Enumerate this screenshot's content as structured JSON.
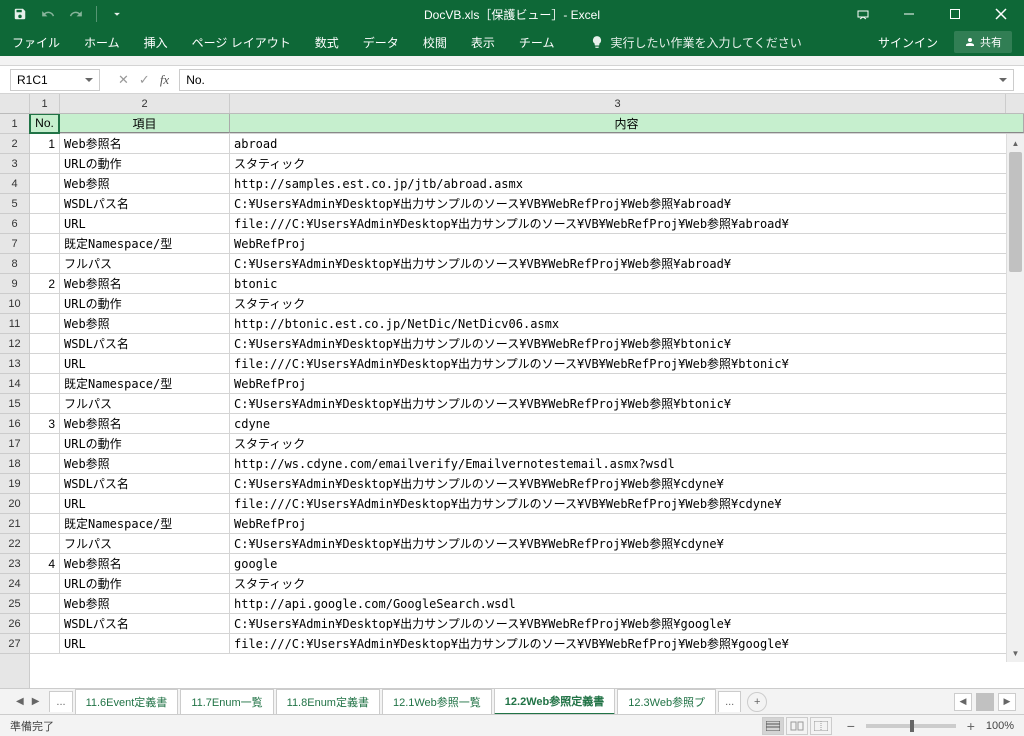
{
  "title": "DocVB.xls［保護ビュー］- Excel",
  "qat": {
    "save": "save",
    "undo": "undo",
    "redo": "redo"
  },
  "ribbon": {
    "file": "ファイル",
    "home": "ホーム",
    "insert": "挿入",
    "pagelayout": "ページ レイアウト",
    "formulas": "数式",
    "data": "データ",
    "review": "校閲",
    "view": "表示",
    "team": "チーム",
    "tellme": "実行したい作業を入力してください",
    "signin": "サインイン",
    "share": "共有"
  },
  "namebox": "R1C1",
  "fx_cancel": "✕",
  "fx_enter": "✓",
  "fx_label": "fx",
  "formula": "No.",
  "col_labels": [
    "1",
    "2",
    "3"
  ],
  "headers": {
    "no": "No.",
    "item": "項目",
    "content": "内容"
  },
  "rows": [
    {
      "n": "1",
      "no": "1",
      "item": "Web参照名",
      "content": "abroad"
    },
    {
      "n": "2",
      "no": "",
      "item": "URLの動作",
      "content": "スタティック"
    },
    {
      "n": "3",
      "no": "",
      "item": "Web参照",
      "content": "http://samples.est.co.jp/jtb/abroad.asmx"
    },
    {
      "n": "4",
      "no": "",
      "item": "WSDLパス名",
      "content": "C:¥Users¥Admin¥Desktop¥出力サンプルのソース¥VB¥WebRefProj¥Web参照¥abroad¥"
    },
    {
      "n": "5",
      "no": "",
      "item": "URL",
      "content": "file:///C:¥Users¥Admin¥Desktop¥出力サンプルのソース¥VB¥WebRefProj¥Web参照¥abroad¥"
    },
    {
      "n": "6",
      "no": "",
      "item": "既定Namespace/型",
      "content": "WebRefProj"
    },
    {
      "n": "7",
      "no": "",
      "item": "フルパス",
      "content": "C:¥Users¥Admin¥Desktop¥出力サンプルのソース¥VB¥WebRefProj¥Web参照¥abroad¥"
    },
    {
      "n": "8",
      "no": "2",
      "item": "Web参照名",
      "content": "btonic"
    },
    {
      "n": "9",
      "no": "",
      "item": "URLの動作",
      "content": "スタティック"
    },
    {
      "n": "10",
      "no": "",
      "item": "Web参照",
      "content": "http://btonic.est.co.jp/NetDic/NetDicv06.asmx"
    },
    {
      "n": "11",
      "no": "",
      "item": "WSDLパス名",
      "content": "C:¥Users¥Admin¥Desktop¥出力サンプルのソース¥VB¥WebRefProj¥Web参照¥btonic¥"
    },
    {
      "n": "12",
      "no": "",
      "item": "URL",
      "content": "file:///C:¥Users¥Admin¥Desktop¥出力サンプルのソース¥VB¥WebRefProj¥Web参照¥btonic¥"
    },
    {
      "n": "13",
      "no": "",
      "item": "既定Namespace/型",
      "content": "WebRefProj"
    },
    {
      "n": "14",
      "no": "",
      "item": "フルパス",
      "content": "C:¥Users¥Admin¥Desktop¥出力サンプルのソース¥VB¥WebRefProj¥Web参照¥btonic¥"
    },
    {
      "n": "15",
      "no": "3",
      "item": "Web参照名",
      "content": "cdyne"
    },
    {
      "n": "16",
      "no": "",
      "item": "URLの動作",
      "content": "スタティック"
    },
    {
      "n": "17",
      "no": "",
      "item": "Web参照",
      "content": "http://ws.cdyne.com/emailverify/Emailvernotestemail.asmx?wsdl"
    },
    {
      "n": "18",
      "no": "",
      "item": "WSDLパス名",
      "content": "C:¥Users¥Admin¥Desktop¥出力サンプルのソース¥VB¥WebRefProj¥Web参照¥cdyne¥"
    },
    {
      "n": "19",
      "no": "",
      "item": "URL",
      "content": "file:///C:¥Users¥Admin¥Desktop¥出力サンプルのソース¥VB¥WebRefProj¥Web参照¥cdyne¥"
    },
    {
      "n": "20",
      "no": "",
      "item": "既定Namespace/型",
      "content": "WebRefProj"
    },
    {
      "n": "21",
      "no": "",
      "item": "フルパス",
      "content": "C:¥Users¥Admin¥Desktop¥出力サンプルのソース¥VB¥WebRefProj¥Web参照¥cdyne¥"
    },
    {
      "n": "22",
      "no": "4",
      "item": "Web参照名",
      "content": "google"
    },
    {
      "n": "23",
      "no": "",
      "item": "URLの動作",
      "content": "スタティック"
    },
    {
      "n": "24",
      "no": "",
      "item": "Web参照",
      "content": "http://api.google.com/GoogleSearch.wsdl"
    },
    {
      "n": "25",
      "no": "",
      "item": "WSDLパス名",
      "content": "C:¥Users¥Admin¥Desktop¥出力サンプルのソース¥VB¥WebRefProj¥Web参照¥google¥"
    },
    {
      "n": "26",
      "no": "",
      "item": "URL",
      "content": "file:///C:¥Users¥Admin¥Desktop¥出力サンプルのソース¥VB¥WebRefProj¥Web参照¥google¥"
    }
  ],
  "row_header_start": 1,
  "sheets": {
    "ellipsis": "...",
    "t1": "11.6Event定義書",
    "t2": "11.7Enum一覧",
    "t3": "11.8Enum定義書",
    "t4": "12.1Web参照一覧",
    "t5": "12.2Web参照定義書",
    "t6": "12.3Web参照プ",
    "ellipsis2": "...",
    "add": "+"
  },
  "status": {
    "ready": "準備完了",
    "zoom": "100%",
    "minus": "−",
    "plus": "+"
  }
}
